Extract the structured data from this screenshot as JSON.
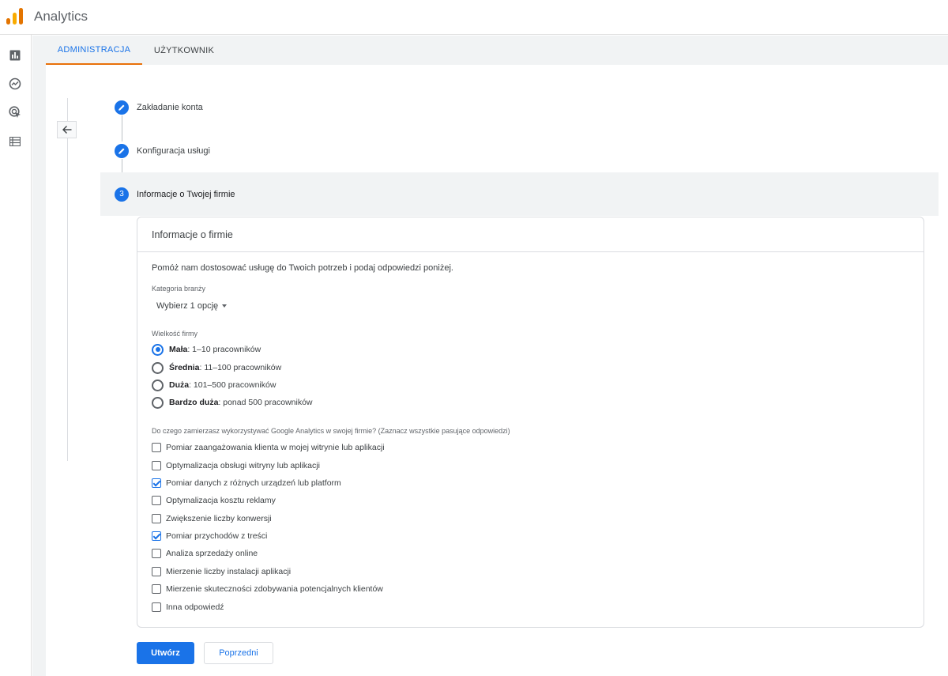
{
  "app": {
    "title": "Analytics"
  },
  "tabs": [
    {
      "label": "ADMINISTRACJA"
    },
    {
      "label": "UŻYTKOWNIK"
    }
  ],
  "stepper": {
    "steps": [
      {
        "label": "Zakładanie konta",
        "state": "edit"
      },
      {
        "label": "Konfiguracja usługi",
        "state": "edit"
      },
      {
        "label": "Informacje o Twojej firmie",
        "state": "active",
        "number": "3"
      }
    ]
  },
  "card": {
    "title": "Informacje o firmie",
    "intro": "Pomóż nam dostosować usługę do Twoich potrzeb i podaj odpowiedzi poniżej.",
    "industry": {
      "label": "Kategoria branży",
      "value": "Wybierz 1 opcję"
    },
    "size": {
      "label": "Wielkość firmy",
      "options": [
        {
          "bold": "Mała",
          "rest": ": 1–10 pracowników",
          "selected": true
        },
        {
          "bold": "Średnia",
          "rest": ": 11–100 pracowników",
          "selected": false
        },
        {
          "bold": "Duża",
          "rest": ": 101–500 pracowników",
          "selected": false
        },
        {
          "bold": "Bardzo duża",
          "rest": ": ponad 500 pracowników",
          "selected": false
        }
      ]
    },
    "usage": {
      "label": "Do czego zamierzasz wykorzystywać Google Analytics w swojej firmie? (Zaznacz wszystkie pasujące odpowiedzi)",
      "options": [
        {
          "label": "Pomiar zaangażowania klienta w mojej witrynie lub aplikacji",
          "checked": false
        },
        {
          "label": "Optymalizacja obsługi witryny lub aplikacji",
          "checked": false
        },
        {
          "label": "Pomiar danych z różnych urządzeń lub platform",
          "checked": true
        },
        {
          "label": "Optymalizacja kosztu reklamy",
          "checked": false
        },
        {
          "label": "Zwiększenie liczby konwersji",
          "checked": false
        },
        {
          "label": "Pomiar przychodów z treści",
          "checked": true
        },
        {
          "label": "Analiza sprzedaży online",
          "checked": false
        },
        {
          "label": "Mierzenie liczby instalacji aplikacji",
          "checked": false
        },
        {
          "label": "Mierzenie skuteczności zdobywania potencjalnych klientów",
          "checked": false
        },
        {
          "label": "Inna odpowiedź",
          "checked": false
        }
      ]
    }
  },
  "buttons": {
    "create": "Utwórz",
    "previous": "Poprzedni"
  },
  "colors": {
    "accent": "#1a73e8",
    "tab_indicator": "#e8710a"
  }
}
